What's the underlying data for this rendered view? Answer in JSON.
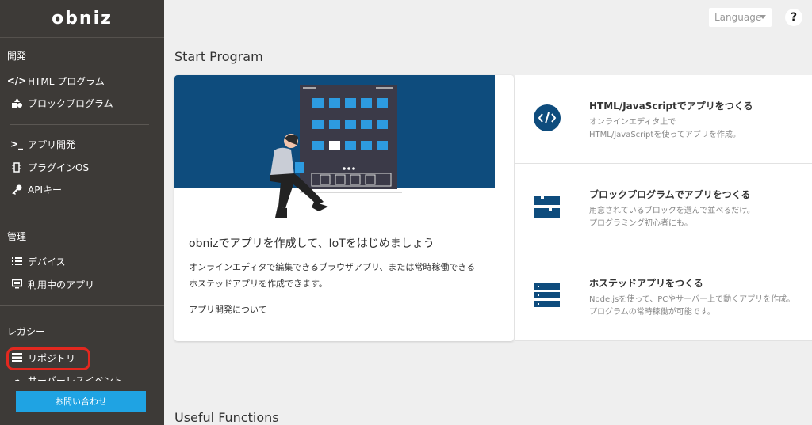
{
  "brand": {
    "logo": "obniz"
  },
  "sidebar": {
    "sections": [
      {
        "title": "開発",
        "items": [
          {
            "label": "HTML プログラム",
            "icon": "code-icon"
          },
          {
            "label": "ブロックプログラム",
            "icon": "shapes-icon"
          },
          {
            "label": "アプリ開発",
            "icon": "terminal-icon"
          },
          {
            "label": "プラグインOS",
            "icon": "chip-icon"
          },
          {
            "label": "APIキー",
            "icon": "key-icon"
          }
        ]
      },
      {
        "title": "管理",
        "items": [
          {
            "label": "デバイス",
            "icon": "list-icon"
          },
          {
            "label": "利用中のアプリ",
            "icon": "monitor-icon"
          }
        ]
      },
      {
        "title": "レガシー",
        "items": [
          {
            "label": "リポジトリ",
            "icon": "server-icon"
          },
          {
            "label": "サーバーレスイベント",
            "icon": "cloud-icon"
          }
        ]
      }
    ],
    "contact_button": "お問い合わせ"
  },
  "header": {
    "language_label": "Language",
    "help_label": "?"
  },
  "main": {
    "start_program_title": "Start Program",
    "card": {
      "heading": "obnizでアプリを作成して、IoTをはじめましょう",
      "description": "オンラインエディタで編集できるブラウザアプリ、または常時稼働できるホステッドアプリを作成できます。",
      "link": "アプリ開発について"
    },
    "options": [
      {
        "title": "HTML/JavaScriptでアプリをつくる",
        "desc1": "オンラインエディタ上で",
        "desc2": "HTML/JavaScriptを使ってアプリを作成。",
        "icon": "code-circle-icon"
      },
      {
        "title": "ブロックプログラムでアプリをつくる",
        "desc1": "用意されているブロックを選んで並べるだけ。",
        "desc2": "プログラミング初心者にも。",
        "icon": "blocks-icon"
      },
      {
        "title": "ホステッドアプリをつくる",
        "desc1": "Node.jsを使って、PCやサーバー上で動くアプリを作成。",
        "desc2": "プログラムの常時稼働が可能です。",
        "icon": "server-stack-icon"
      }
    ],
    "useful_functions_title": "Useful Functions"
  },
  "colors": {
    "sidebar_bg": "#3d3a37",
    "accent_blue": "#1fa3e3",
    "navy": "#0e4c7d",
    "highlight_red": "#e3281f"
  }
}
